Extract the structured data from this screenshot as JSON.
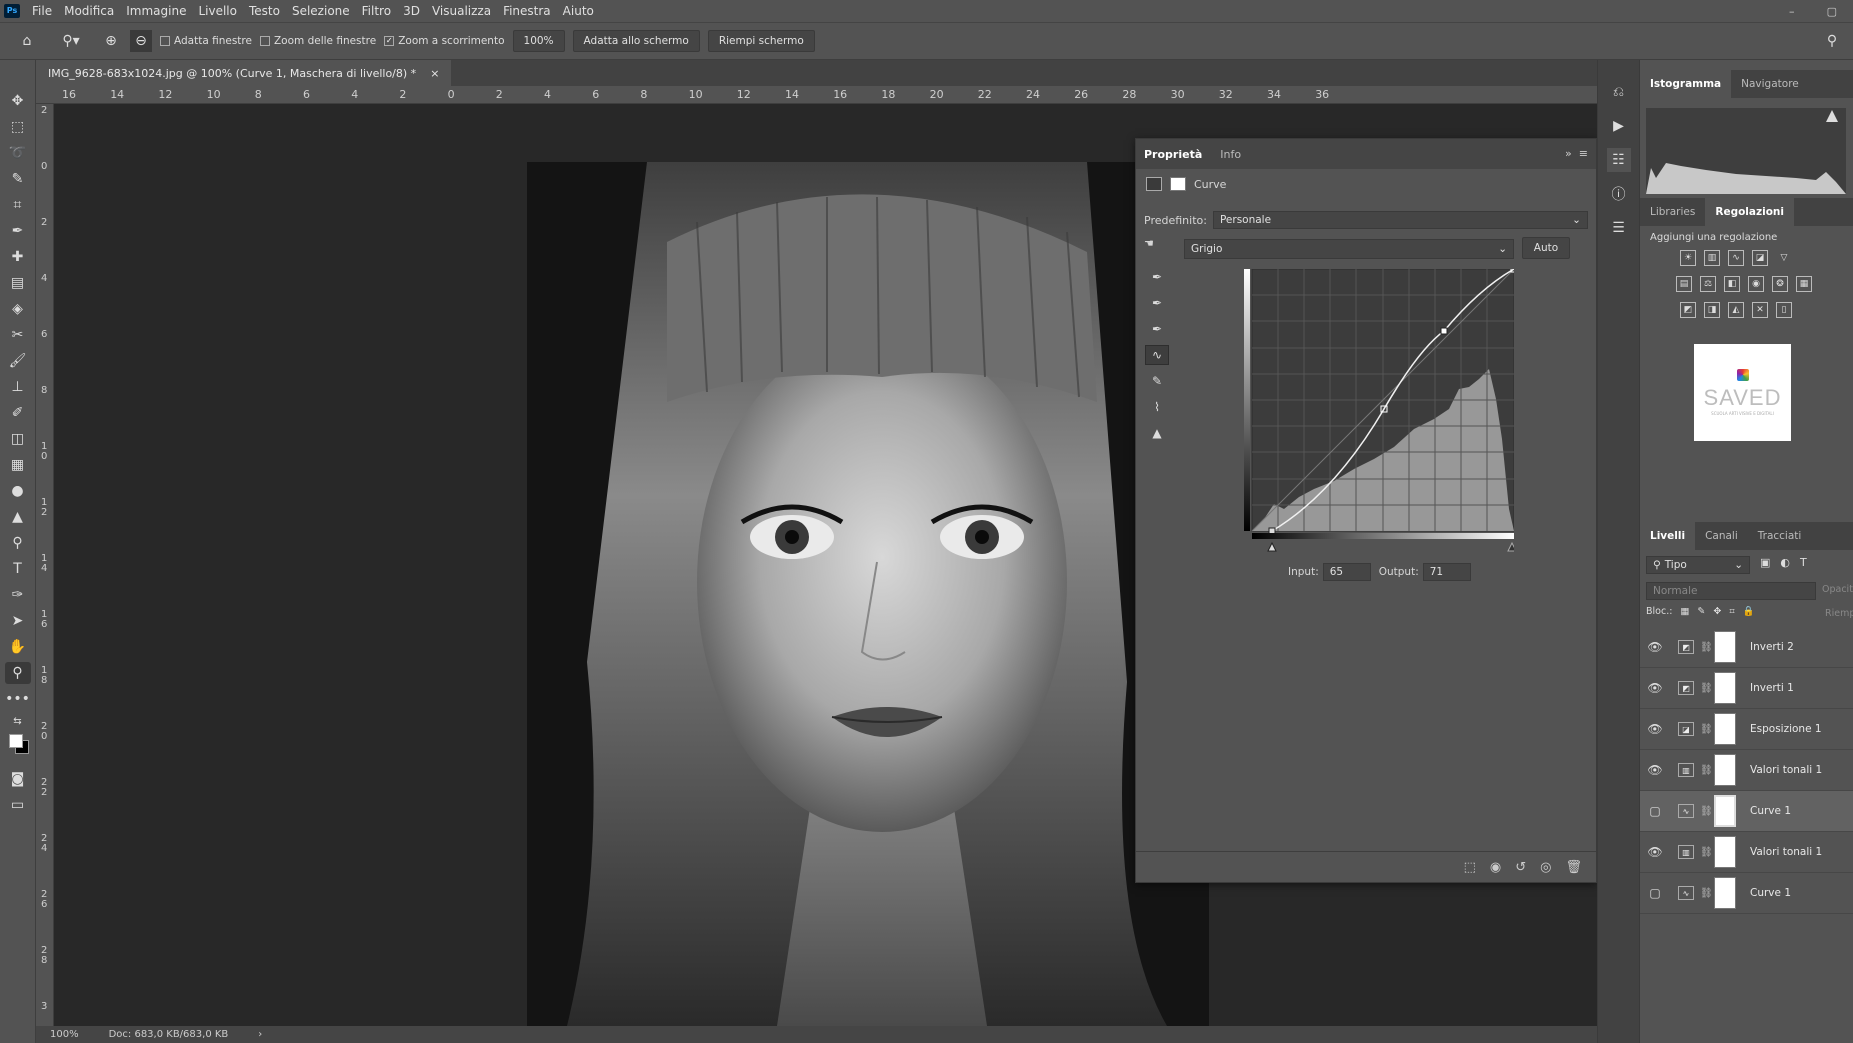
{
  "app": {
    "logo": "Ps"
  },
  "menu": [
    "File",
    "Modifica",
    "Immagine",
    "Livello",
    "Testo",
    "Selezione",
    "Filtro",
    "3D",
    "Visualizza",
    "Finestra",
    "Aiuto"
  ],
  "options": {
    "fit_windows": "Adatta finestre",
    "zoom_windows": "Zoom delle finestre",
    "scrubby_zoom": "Zoom a scorrimento",
    "zoom_value": "100%",
    "fit_screen": "Adatta allo schermo",
    "fill_screen": "Riempi schermo"
  },
  "document": {
    "tab_title": "IMG_9628-683x1024.jpg @ 100% (Curve 1, Maschera di livello/8) *",
    "ruler_h": [
      "16",
      "14",
      "12",
      "10",
      "8",
      "6",
      "4",
      "2",
      "0",
      "2",
      "4",
      "6",
      "8",
      "10",
      "12",
      "14",
      "16",
      "18",
      "20",
      "22",
      "24",
      "26",
      "28",
      "30",
      "32",
      "34",
      "36"
    ],
    "ruler_v": [
      "2",
      "0",
      "2",
      "4",
      "6",
      "8",
      "1\n0",
      "1\n2",
      "1\n4",
      "1\n6",
      "1\n8",
      "2\n0",
      "2\n2",
      "2\n4",
      "2\n6",
      "2\n8",
      "3"
    ]
  },
  "status": {
    "zoom": "100%",
    "doc": "Doc: 683,0 KB/683,0 KB"
  },
  "properties": {
    "tabs": [
      "Proprietà",
      "Info"
    ],
    "adjustment": "Curve",
    "preset_label": "Predefinito:",
    "preset_value": "Personale",
    "channel": "Grigio",
    "auto": "Auto",
    "input_label": "Input:",
    "input_value": "65",
    "output_label": "Output:",
    "output_value": "71"
  },
  "right_panel": {
    "top_tabs": [
      "Istogramma",
      "Navigatore"
    ],
    "mid_tabs": [
      "Libraries",
      "Regolazioni"
    ],
    "add_adjustment": "Aggiungi una regolazione",
    "saved_logo": "SAVED",
    "saved_tagline": "SCUOLA ARTI VISIVE E DIGITALI",
    "layer_tabs": [
      "Livelli",
      "Canali",
      "Tracciati"
    ],
    "filter_kind": "Tipo",
    "blend_mode": "Normale",
    "opacity_label": "Opacità",
    "lock_label": "Bloc.:",
    "fill_label": "Riemp",
    "layers": [
      {
        "name": "Inverti 2",
        "icon": "invert",
        "visible": true
      },
      {
        "name": "Inverti 1",
        "icon": "invert",
        "visible": true
      },
      {
        "name": "Esposizione 1",
        "icon": "exposure",
        "visible": true
      },
      {
        "name": "Valori tonali 1",
        "icon": "levels",
        "visible": true
      },
      {
        "name": "Curve 1",
        "icon": "curves",
        "visible": false
      },
      {
        "name": "Valori tonali 1",
        "icon": "levels",
        "visible": true
      },
      {
        "name": "Curve 1",
        "icon": "curves",
        "visible": false
      }
    ]
  }
}
